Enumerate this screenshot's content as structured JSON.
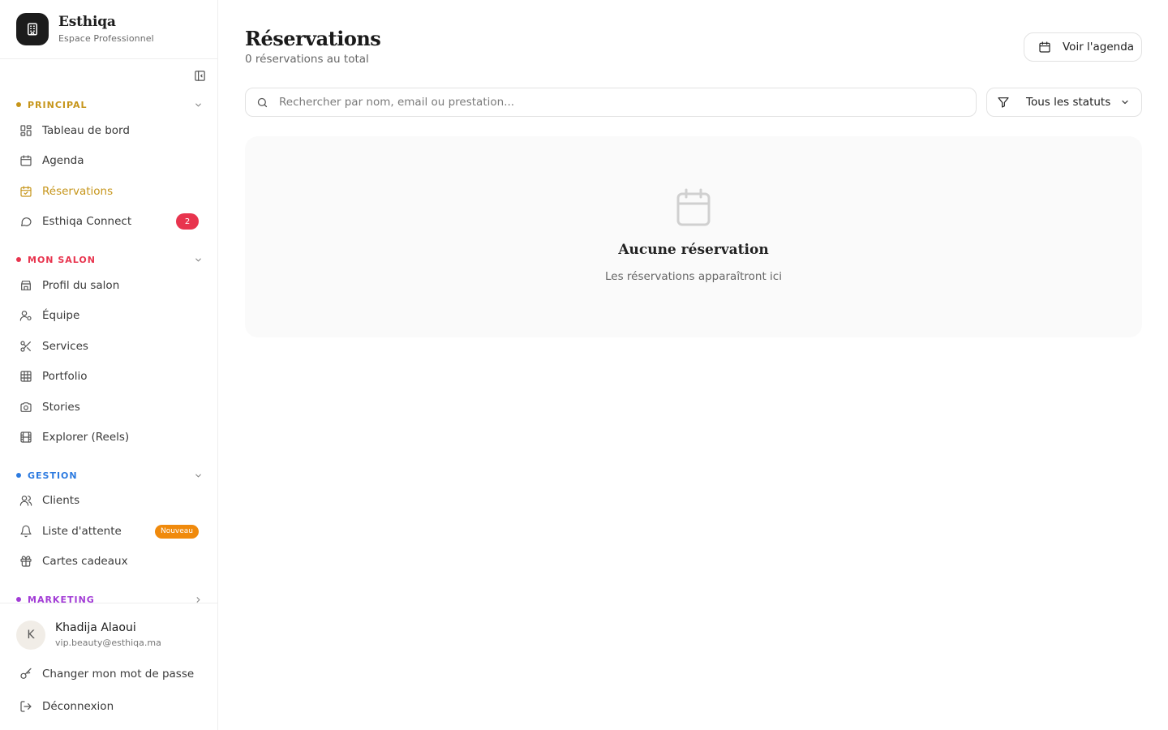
{
  "brand": {
    "name": "Esthiqa",
    "subtitle": "Espace Professionnel"
  },
  "colors": {
    "principal": "#c6951a",
    "mon_salon": "#e8344e",
    "gestion": "#2d7be0",
    "marketing": "#a23bd6",
    "badge_count": "#e8344e",
    "badge_new": "#f08a0c"
  },
  "sidebar": {
    "sections": [
      {
        "title": "PRINCIPAL",
        "items": [
          {
            "label": "Tableau de bord",
            "icon": "dashboard-icon"
          },
          {
            "label": "Agenda",
            "icon": "calendar-icon"
          },
          {
            "label": "Réservations",
            "icon": "calendar-check-icon",
            "active": true
          },
          {
            "label": "Esthiqa Connect",
            "icon": "chat-icon",
            "badge": "2"
          }
        ]
      },
      {
        "title": "MON SALON",
        "items": [
          {
            "label": "Profil du salon",
            "icon": "store-icon"
          },
          {
            "label": "Équipe",
            "icon": "team-icon"
          },
          {
            "label": "Services",
            "icon": "scissors-icon"
          },
          {
            "label": "Portfolio",
            "icon": "grid-icon"
          },
          {
            "label": "Stories",
            "icon": "camera-icon"
          },
          {
            "label": "Explorer (Reels)",
            "icon": "film-icon"
          }
        ]
      },
      {
        "title": "GESTION",
        "items": [
          {
            "label": "Clients",
            "icon": "users-icon"
          },
          {
            "label": "Liste d'attente",
            "icon": "bell-icon",
            "badge": "Nouveau"
          },
          {
            "label": "Cartes cadeaux",
            "icon": "gift-icon"
          }
        ]
      },
      {
        "title": "MARKETING",
        "items": []
      }
    ]
  },
  "user": {
    "initial": "K",
    "name": "Khadija Alaoui",
    "email": "vip.beauty@esthiqa.ma",
    "change_password": "Changer mon mot de passe",
    "logout": "Déconnexion"
  },
  "main": {
    "title": "Réservations",
    "subtitle": "0 réservations au total",
    "agenda_button": "Voir l'agenda",
    "search_placeholder": "Rechercher par nom, email ou prestation...",
    "status_filter": "Tous les statuts",
    "empty_title": "Aucune réservation",
    "empty_subtitle": "Les réservations apparaîtront ici"
  }
}
